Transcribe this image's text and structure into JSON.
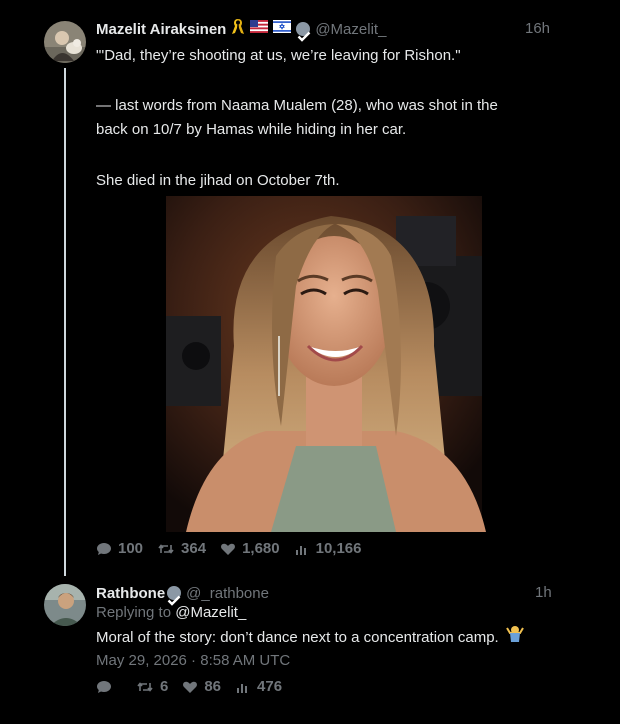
{
  "tweet1": {
    "display_name": "Mazelit Airaksinen",
    "handle": "@Mazelit_",
    "time": "16h",
    "paragraphs": [
      "\"'Dad, they’re shooting at us, we’re leaving for Rishon.\"",
      "— last words from Naama Mualem (28), who was shot in the",
      "back on 10/7 by Hamas while hiding in her car.",
      "She died in the jihad on October 7th."
    ],
    "stats": {
      "replies": "100",
      "retweets": "364",
      "likes": "1,680",
      "views": "10,166"
    }
  },
  "tweet2": {
    "display_name": "Rathbone",
    "handle": "@_rathbone",
    "time": "1h",
    "replying_prefix": "Replying to ",
    "replying_handle": "@Mazelit_",
    "text": "Moral of the story: don’t dance next to a concentration camp.",
    "date": "May 29, 2026 · 8:58 AM UTC",
    "stats": {
      "retweets": "6",
      "likes": "86",
      "views": "476"
    }
  },
  "colors": {
    "background": "#000000",
    "text": "#e7e9ea",
    "muted": "#71767b",
    "thread_line": "#cfd9de"
  },
  "icons": [
    "reply-icon",
    "retweet-icon",
    "like-icon",
    "views-icon",
    "verified-icon",
    "ribbon-icon",
    "us-flag-icon",
    "israel-flag-icon",
    "shrug-emoji-icon"
  ]
}
